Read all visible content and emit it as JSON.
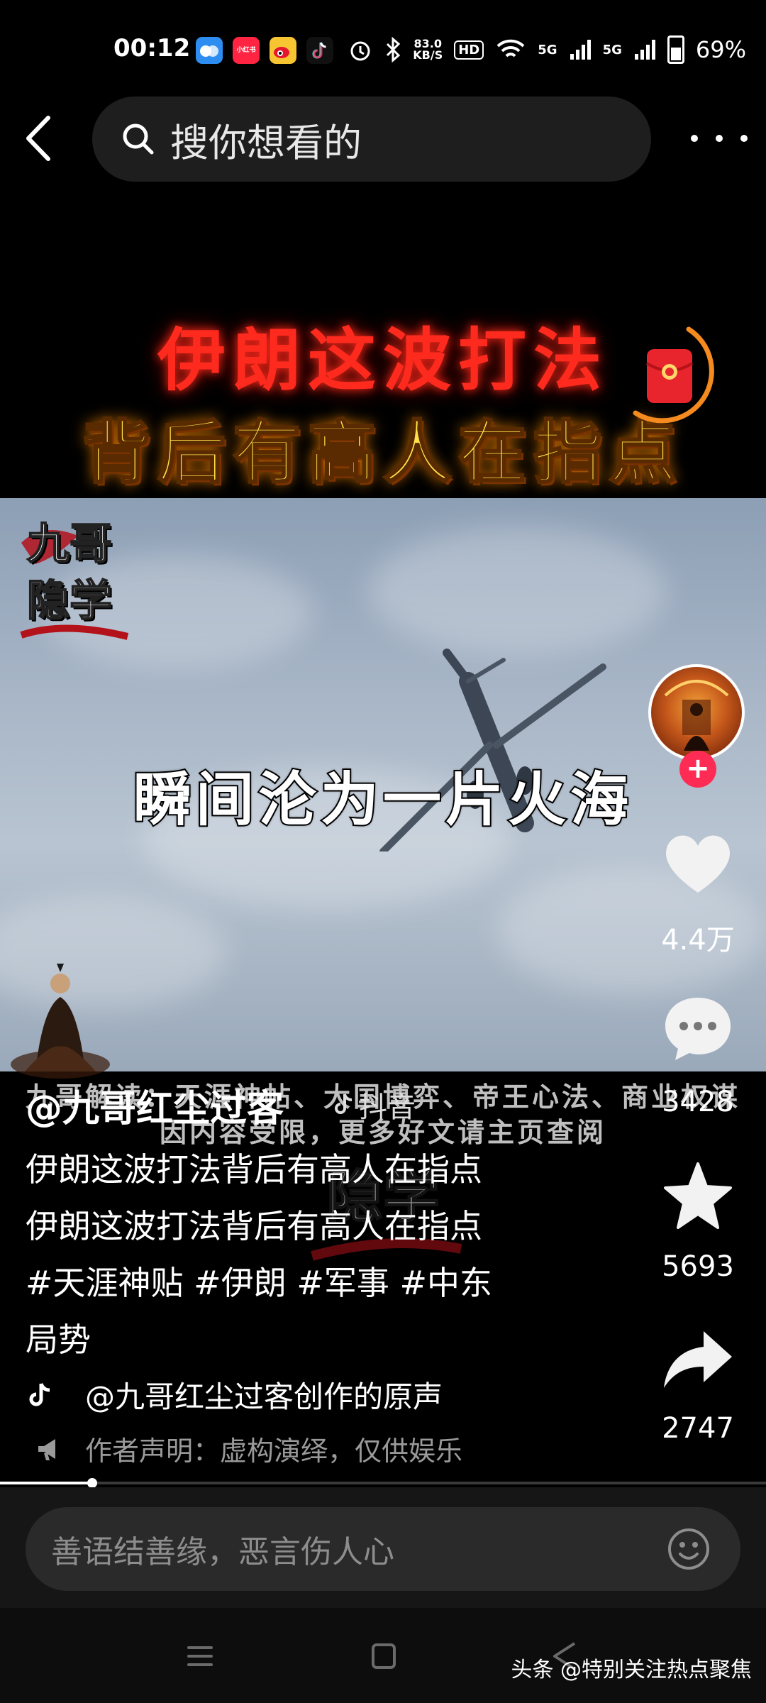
{
  "status_bar": {
    "time": "00:12",
    "app_icons": [
      "baidu-netdisk",
      "xiaohongshu",
      "weibo",
      "douyin"
    ],
    "xiaohongshu_label": "小红书",
    "net_speed_value": "83.0",
    "net_speed_unit": "KB/S",
    "hd_label": "HD",
    "signal_1": "5G",
    "signal_2": "5G",
    "battery": "69%"
  },
  "top_nav": {
    "search_placeholder": "搜你想看的"
  },
  "video": {
    "title_line1": "伊朗这波打法",
    "title_line2": "背后有高人在指点",
    "channel_logo": [
      "九哥",
      "隐学"
    ],
    "subtitle": "瞬间沦为一片火海",
    "overlay_line1": "九哥解读：天涯神帖、大国博弈、帝王心法、商业权谋",
    "overlay_line2": "因内容受限，更多好文请主页查阅",
    "watermark_text": "隐学"
  },
  "right_rail": {
    "likes": "4.4万",
    "comments": "3428",
    "favorites": "5693",
    "shares": "2747",
    "follow_symbol": "+"
  },
  "caption": {
    "author": "@九哥红尘过客",
    "platform": "抖音",
    "line1": "伊朗这波打法背后有高人在指点",
    "line2": "伊朗这波打法背后有高人在指点",
    "line3": "#天涯神贴 #伊朗 #军事 #中东",
    "line4": "局势",
    "music": "@九哥红尘过客创作的原声",
    "declaration": "作者声明：虚构演绎，仅供娱乐"
  },
  "playback": {
    "progress_fraction": 0.12
  },
  "comment_bar": {
    "placeholder": "善语结善缘，恶言伤人心"
  },
  "footer": {
    "source_mark": "头条 @特别关注热点聚焦"
  },
  "colors": {
    "title_red": "#ff2a1e",
    "title_yellow": "#ffe14a",
    "follow_pink": "#fe2c55",
    "red_packet": "#e8252c",
    "ring_orange": "#f58a1f"
  }
}
